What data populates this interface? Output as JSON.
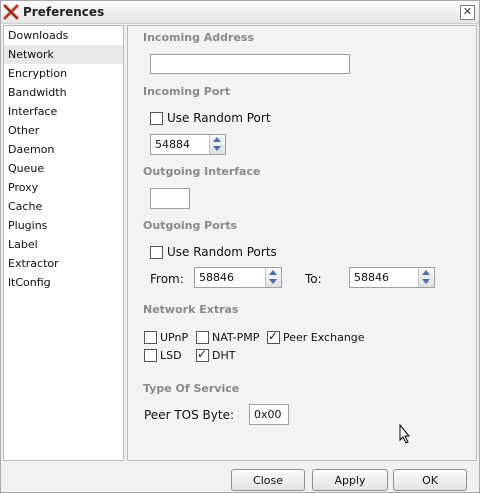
{
  "window": {
    "title": "Preferences"
  },
  "sidebar": {
    "items": [
      {
        "label": "Downloads"
      },
      {
        "label": "Network",
        "selected": true
      },
      {
        "label": "Encryption"
      },
      {
        "label": "Bandwidth"
      },
      {
        "label": "Interface"
      },
      {
        "label": "Other"
      },
      {
        "label": "Daemon"
      },
      {
        "label": "Queue"
      },
      {
        "label": "Proxy"
      },
      {
        "label": "Cache"
      },
      {
        "label": "Plugins"
      },
      {
        "label": "Label"
      },
      {
        "label": "Extractor"
      },
      {
        "label": "ltConfig"
      }
    ]
  },
  "network": {
    "incoming_address": {
      "heading": "Incoming Address",
      "value": ""
    },
    "incoming_port": {
      "heading": "Incoming Port",
      "random_label": "Use Random Port",
      "random_checked": false,
      "port": "54884"
    },
    "outgoing_interface": {
      "heading": "Outgoing Interface",
      "value": ""
    },
    "outgoing_ports": {
      "heading": "Outgoing Ports",
      "random_label": "Use Random Ports",
      "random_checked": false,
      "from_label": "From:",
      "from_value": "58846",
      "to_label": "To:",
      "to_value": "58846"
    },
    "extras": {
      "heading": "Network Extras",
      "upnp": {
        "label": "UPnP",
        "checked": false
      },
      "natpmp": {
        "label": "NAT-PMP",
        "checked": false
      },
      "pex": {
        "label": "Peer Exchange",
        "checked": true
      },
      "lsd": {
        "label": "LSD",
        "checked": false
      },
      "dht": {
        "label": "DHT",
        "checked": true
      }
    },
    "tos": {
      "heading": "Type Of Service",
      "label": "Peer TOS Byte:",
      "value": "0x00"
    }
  },
  "buttons": {
    "close": "Close",
    "apply": "Apply",
    "ok": "OK"
  },
  "icons": {
    "app": "deluge-x-icon",
    "close": "close-icon",
    "cursor": "mouse-pointer-icon"
  }
}
